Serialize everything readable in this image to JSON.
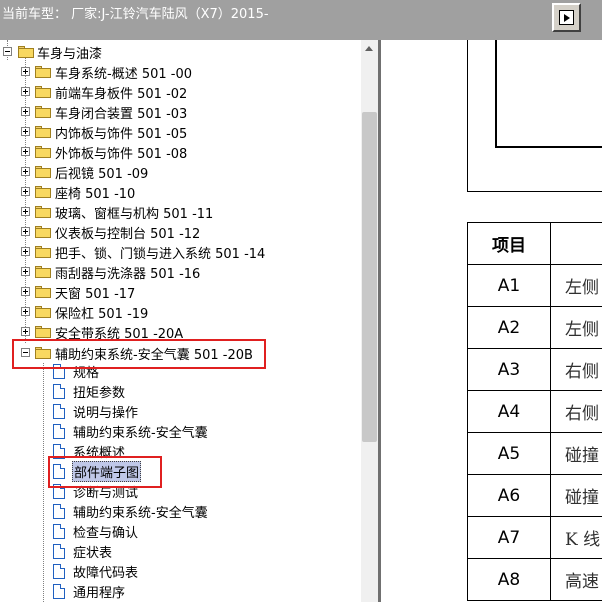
{
  "header": {
    "title": "当前车型：   厂家:J-江铃汽车陆风（X7）2015-"
  },
  "tree": {
    "root": {
      "label": "车身与油漆"
    },
    "folders": [
      {
        "label": "车身系统-概述 501 -00"
      },
      {
        "label": "前端车身板件 501 -02"
      },
      {
        "label": "车身闭合装置 501 -03"
      },
      {
        "label": "内饰板与饰件 501 -05"
      },
      {
        "label": "外饰板与饰件 501 -08"
      },
      {
        "label": "后视镜 501 -09"
      },
      {
        "label": "座椅 501 -10"
      },
      {
        "label": "玻璃、窗框与机构 501 -11"
      },
      {
        "label": "仪表板与控制台 501 -12"
      },
      {
        "label": "把手、锁、门锁与进入系统 501 -14"
      },
      {
        "label": "雨刮器与洗涤器 501 -16"
      },
      {
        "label": "天窗 501 -17"
      },
      {
        "label": "保险杠 501 -19"
      },
      {
        "label": "安全带系统 501 -20A"
      },
      {
        "label": "辅助约束系统-安全气囊 501 -20B"
      }
    ],
    "documents": [
      {
        "label": "规格"
      },
      {
        "label": "扭矩参数"
      },
      {
        "label": "说明与操作"
      },
      {
        "label": "辅助约束系统-安全气囊"
      },
      {
        "label": "系统概述"
      },
      {
        "label": "部件端子图"
      },
      {
        "label": "诊断与测试"
      },
      {
        "label": "辅助约束系统-安全气囊"
      },
      {
        "label": "检查与确认"
      },
      {
        "label": "症状表"
      },
      {
        "label": "故障代码表"
      },
      {
        "label": "通用程序"
      }
    ]
  },
  "table": {
    "header": {
      "col_a": "项目",
      "col_b": ""
    },
    "rows": [
      {
        "item": "A1",
        "desc": "左侧"
      },
      {
        "item": "A2",
        "desc": "左侧"
      },
      {
        "item": "A3",
        "desc": "右侧"
      },
      {
        "item": "A4",
        "desc": "右侧"
      },
      {
        "item": "A5",
        "desc": "碰撞"
      },
      {
        "item": "A6",
        "desc": "碰撞"
      },
      {
        "item": "A7",
        "desc": "K 线"
      },
      {
        "item": "A8",
        "desc": "高速"
      }
    ]
  },
  "colors": {
    "header_bg": "#a0a0a0",
    "highlight_box": "#e02020",
    "selection": "#c0c8e8",
    "folder": "#f8d860"
  },
  "icons": [
    "folder-icon",
    "document-icon",
    "expand-icon",
    "collapse-icon",
    "toggle-panel-icon"
  ]
}
